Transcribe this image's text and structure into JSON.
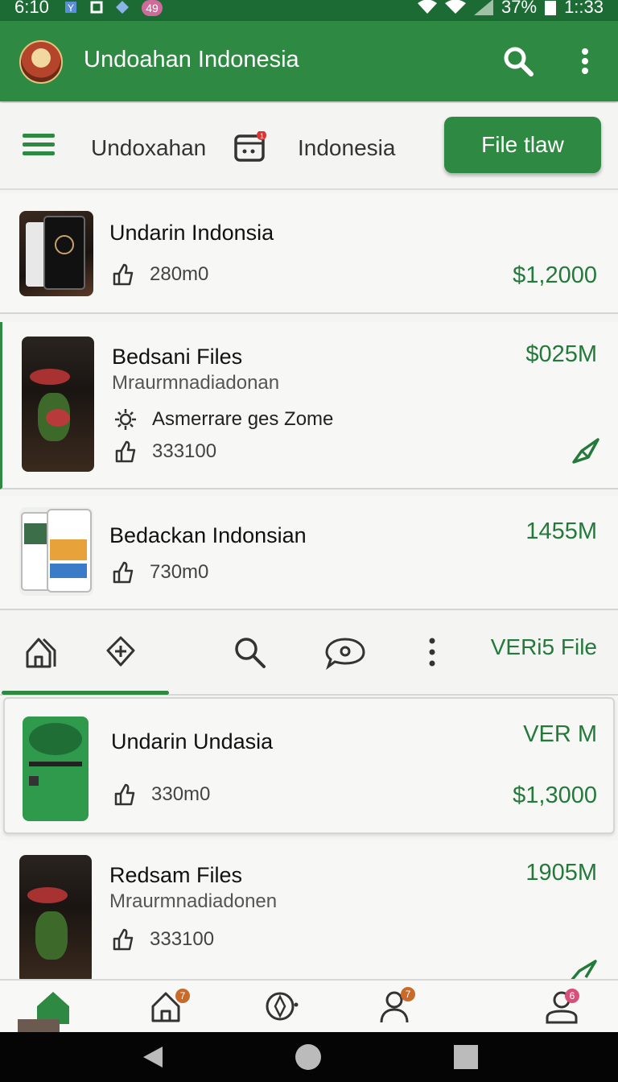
{
  "status_bar": {
    "time": "6:10",
    "badge_count": "49",
    "battery": "37%",
    "right_time": "1::33"
  },
  "app_bar": {
    "title": "Undoahan Indonesia"
  },
  "toolbar": {
    "left_label": "Undoxahan",
    "right_label": "Indonesia",
    "button_label": "File tlaw"
  },
  "cards": [
    {
      "title": "Undarin Indonsia",
      "subtitle": "",
      "extra": "",
      "metric": "280m0",
      "price": "$1,2000"
    },
    {
      "title": "Bedsani Files",
      "subtitle": "Mraurmnadiadonan",
      "extra": "Asmerrare ges Zome",
      "metric": "333100",
      "price": "$025M"
    },
    {
      "title": "Bedackan Indonsian",
      "subtitle": "",
      "extra": "",
      "metric": "730m0",
      "price": "1455M"
    },
    {
      "title": "Undarin Undasia",
      "subtitle": "",
      "extra": "",
      "metric": "330m0",
      "price": "$1,3000",
      "tag": "VER M"
    },
    {
      "title": "Redsam Files",
      "subtitle": "Mraurmnadiadonen",
      "extra": "",
      "metric": "333100",
      "price": "1905M"
    }
  ],
  "tabs": {
    "right_label": "VERi5 File"
  },
  "bottom_nav": {
    "badge_1": "7",
    "badge_2": "7",
    "badge_3": "6"
  },
  "colors": {
    "primary": "#2e8a42",
    "primary_dark": "#1d6b34",
    "accent_text": "#237a3a"
  }
}
